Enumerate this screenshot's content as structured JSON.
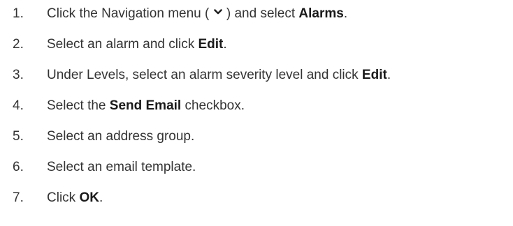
{
  "steps": [
    {
      "number": "1.",
      "parts": {
        "a": "Click the Navigation menu ( ",
        "icon": "chevron-down-icon",
        "b": " ) and select ",
        "bold": "Alarms",
        "c": "."
      }
    },
    {
      "number": "2.",
      "parts": {
        "a": "Select an alarm and click ",
        "bold": "Edit",
        "c": "."
      }
    },
    {
      "number": "3.",
      "parts": {
        "a": "Under Levels, select an alarm severity level and click ",
        "bold": "Edit",
        "c": "."
      }
    },
    {
      "number": "4.",
      "parts": {
        "a": "Select the ",
        "bold": "Send Email",
        "c": " checkbox."
      }
    },
    {
      "number": "5.",
      "parts": {
        "a": "Select an address group."
      }
    },
    {
      "number": "6.",
      "parts": {
        "a": "Select an email template."
      }
    },
    {
      "number": "7.",
      "parts": {
        "a": "Click ",
        "bold": "OK",
        "c": "."
      }
    }
  ]
}
